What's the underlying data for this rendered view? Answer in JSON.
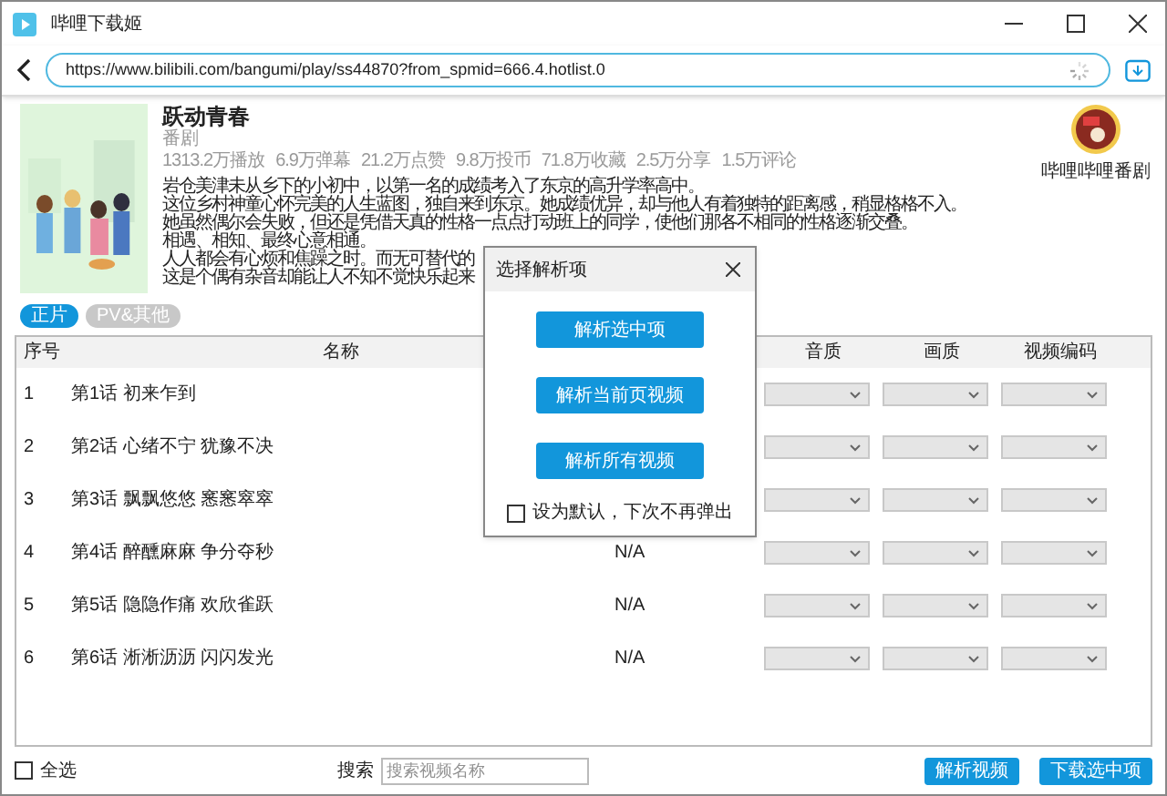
{
  "window": {
    "title": "哔哩下载姬"
  },
  "url": {
    "value": "https://www.bilibili.com/bangumi/play/ss44870?from_spmid=666.4.hotlist.0"
  },
  "show": {
    "title": "跃动青春",
    "category": "番剧",
    "stats": [
      "1313.2万播放",
      "6.9万弹幕",
      "21.2万点赞",
      "9.8万投币",
      "71.8万收藏",
      "2.5万分享",
      "1.5万评论"
    ],
    "description": [
      "岩仓美津未从乡下的小初中，以第一名的成绩考入了东京的高升学率高中。",
      "这位乡村神童心怀完美的人生蓝图，独自来到东京。她成绩优异，却与他人有着独特的距离感，稍显格格不入。",
      "她虽然偶尔会失败，但还是凭借天真的性格一点点打动班上的同学，使他们那各不相同的性格逐渐交叠。",
      "相遇、相知、最终心意相通。",
      "人人都会有心烦和焦躁之时。而无可替代的",
      "这是个偶有杂音却能让人不知不觉快乐起来"
    ],
    "uploader": "哔哩哔哩番剧"
  },
  "tabs": [
    {
      "label": "正片",
      "selected": true
    },
    {
      "label": "PV&其他",
      "selected": false
    }
  ],
  "table": {
    "columns": [
      "序号",
      "名称",
      "音质",
      "画质",
      "视频编码"
    ],
    "rows": [
      {
        "index": "1",
        "name": "第1话 初来乍到"
      },
      {
        "index": "2",
        "name": "第2话 心绪不宁 犹豫不决"
      },
      {
        "index": "3",
        "name": "第3话 飘飘悠悠 窸窸窣窣"
      },
      {
        "index": "4",
        "name": "第4话 醉醺麻麻 争分夺秒",
        "column_3": "N/A"
      },
      {
        "index": "5",
        "name": "第5话 隐隐作痛 欢欣雀跃",
        "column_3": "N/A"
      },
      {
        "index": "6",
        "name": "第6话 淅淅沥沥 闪闪发光",
        "column_3": "N/A"
      }
    ]
  },
  "footer": {
    "select_all": {
      "label": "全选",
      "checked": false
    },
    "search_label": "搜索",
    "search_placeholder": "搜索视频名称",
    "buttons": [
      "解析视频",
      "下载选中项"
    ]
  },
  "dialog": {
    "title": "选择解析项",
    "buttons": [
      "解析选中项",
      "解析当前页视频",
      "解析所有视频"
    ],
    "remember": {
      "label": "设为默认，下次不再弹出",
      "checked": false
    }
  }
}
